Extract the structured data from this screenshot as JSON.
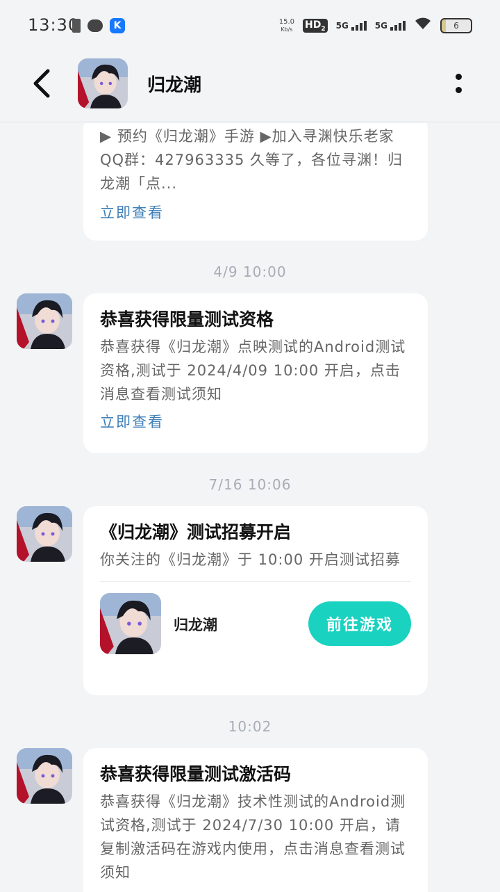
{
  "status_bar": {
    "time": "13:30",
    "net_speed_value": "15.0",
    "net_speed_unit": "Kb/s",
    "hd_label": "HD",
    "hd_sub": "2",
    "signal1_label": "5G",
    "signal2_label": "5G",
    "battery_level": "6",
    "icons": [
      "battery-small-icon",
      "chat-bubble-icon",
      "k-app-icon",
      "hd-icon",
      "signal-5g-icon",
      "signal-5g-icon",
      "wifi-icon",
      "battery-icon"
    ]
  },
  "header": {
    "title": "归龙潮",
    "icons": [
      "back-arrow-icon",
      "more-vertical-icon"
    ]
  },
  "messages": [
    {
      "body": "▶ 预约《归龙潮》手游 ▶加入寻渊快乐老家QQ群：427963335 久等了，各位寻渊！归龙潮「点...",
      "link": "立即查看"
    },
    {
      "time": "4/9   10:00",
      "title": "恭喜获得限量测试资格",
      "body": "恭喜获得《归龙潮》点映测试的Android测试资格,测试于 2024/4/09 10:00 开启，点击消息查看测试须知",
      "link": "立即查看"
    },
    {
      "time": "7/16   10:06",
      "title": "《归龙潮》测试招募开启",
      "body": "你关注的《归龙潮》于 10:00 开启测试招募",
      "game_name": "归龙潮",
      "button": "前往游戏"
    },
    {
      "time": "10:02",
      "title": "恭喜获得限量测试激活码",
      "body": "恭喜获得《归龙潮》技术性测试的Android测试资格,测试于 2024/7/30 10:00 开启，请复制激活码在游戏内使用，点击消息查看测试须知"
    }
  ],
  "colors": {
    "background": "#f3f4f6",
    "card": "#ffffff",
    "link": "#3f7fb8",
    "accent_button": "#19d2c0",
    "timestamp": "#a7adb6"
  }
}
